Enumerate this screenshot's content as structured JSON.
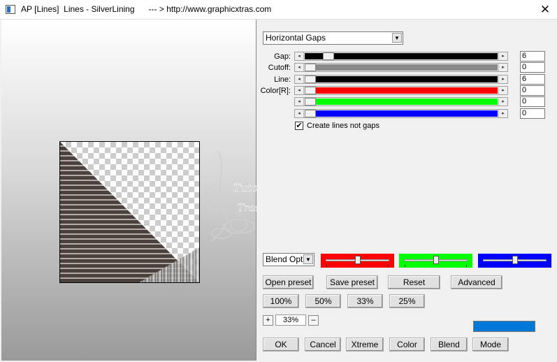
{
  "window": {
    "title": "AP [Lines]  Lines - SilverLining      --- > http://www.graphicxtras.com",
    "close_glyph": "✕"
  },
  "watermark": {
    "line1": "Tuto by Le Monde de Bea",
    "line2": "Traduzido by Nilsa Novais"
  },
  "mode_select": {
    "value": "Horizontal Gaps"
  },
  "sliders": [
    {
      "label": "Gap:",
      "value": "6",
      "level": 0.1,
      "fill": "#000000"
    },
    {
      "label": "Cutoff:",
      "value": "0",
      "level": 0.0,
      "fill": "#888888"
    },
    {
      "label": "Line:",
      "value": "6",
      "level": 0.0,
      "fill": "#000000"
    },
    {
      "label": "Color[R]:",
      "value": "0",
      "level": 0.0,
      "fill": "#ff0000"
    },
    {
      "label": "",
      "value": "0",
      "level": 0.0,
      "fill": "#00ff00"
    },
    {
      "label": "",
      "value": "0",
      "level": 0.0,
      "fill": "#0000ff"
    }
  ],
  "checkbox": {
    "label": "Create lines not gaps",
    "checked": true,
    "mark": "✔"
  },
  "blend_select": {
    "value": "Blend Optio"
  },
  "color_swatches": [
    {
      "color": "#ff0000",
      "level": 0.5
    },
    {
      "color": "#00ff00",
      "level": 0.5
    },
    {
      "color": "#0000ff",
      "level": 0.5
    }
  ],
  "buttons": {
    "open_preset": "Open preset",
    "save_preset": "Save preset",
    "reset": "Reset",
    "advanced": "Advanced",
    "zoom_100": "100%",
    "zoom_50": "50%",
    "zoom_33": "33%",
    "zoom_25": "25%",
    "ok": "OK",
    "cancel": "Cancel",
    "xtreme": "Xtreme",
    "color": "Color",
    "blend": "Blend",
    "mode": "Mode"
  },
  "zoom": {
    "plus": "+",
    "value": "33%",
    "minus": "–"
  },
  "color_bar": {
    "color": "#0078d7"
  },
  "arrows": {
    "left": "◂",
    "right": "▸",
    "down": "▼"
  }
}
